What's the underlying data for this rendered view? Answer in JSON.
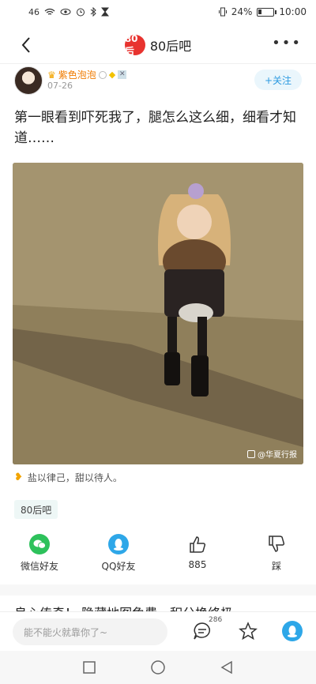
{
  "status_bar": {
    "signal": "46",
    "battery_text": "24%",
    "battery_level": 0.24,
    "time": "10:00"
  },
  "nav": {
    "back_icon": "chevron-left-icon",
    "logo_text": "80后",
    "title": "80后吧",
    "more_icon": "more-horizontal-icon"
  },
  "author": {
    "name": "紫色泡泡",
    "date": "07-26",
    "follow_label": "+关注",
    "colors": {
      "name": "#f07b00",
      "follow": "#2c9ae0"
    }
  },
  "post": {
    "text": "第一眼看到吓死我了，腿怎么这么细，细看才知道……",
    "image_watermark": "@华夏行报",
    "signature": "盐以律己，甜以待人。",
    "tag": "80后吧"
  },
  "actions": {
    "wechat_label": "微信好友",
    "qq_label": "QQ好友",
    "like_count": "885",
    "dislike_label": "踩"
  },
  "next_post": {
    "title": "良心传奇！ 隐藏地图免费，积分换终极"
  },
  "reply_bar": {
    "placeholder": "能不能火就靠你了~",
    "comment_count": "286"
  },
  "system_nav": {
    "back_icon": "triangle-back-icon",
    "home_icon": "circle-home-icon",
    "recent_icon": "square-recent-icon"
  }
}
